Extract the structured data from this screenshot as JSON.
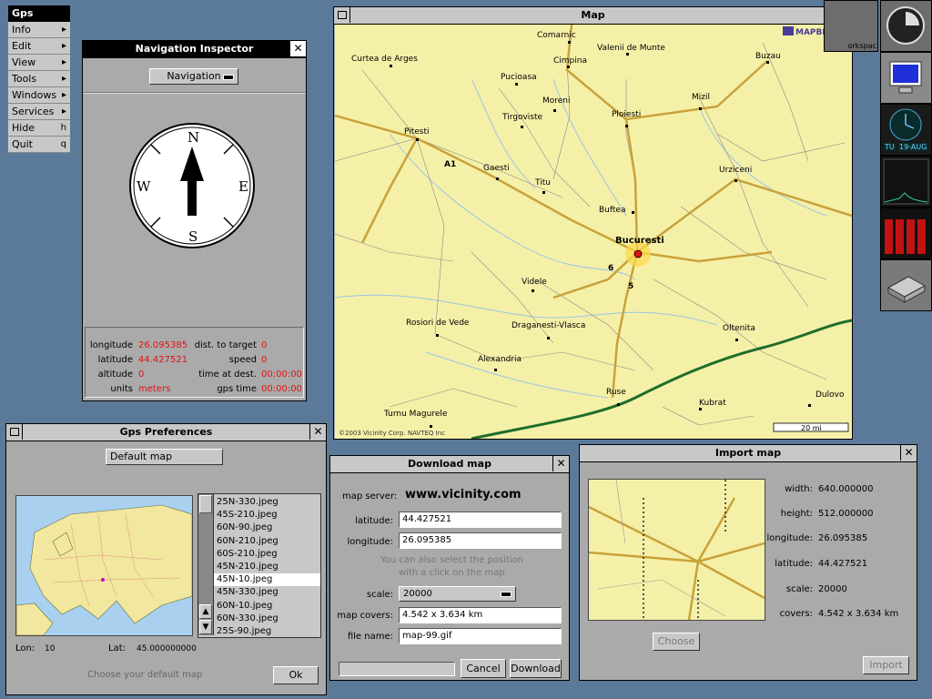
{
  "menu": {
    "title": "Gps",
    "items": [
      {
        "label": "Info",
        "key": "▸"
      },
      {
        "label": "Edit",
        "key": "▸"
      },
      {
        "label": "View",
        "key": "▸"
      },
      {
        "label": "Tools",
        "key": "▸"
      },
      {
        "label": "Windows",
        "key": "▸"
      },
      {
        "label": "Services",
        "key": "▸"
      },
      {
        "label": "Hide",
        "key": "h"
      },
      {
        "label": "Quit",
        "key": "q"
      }
    ]
  },
  "navigator": {
    "title": "Navigation Inspector",
    "mode": "Navigation",
    "compass": {
      "n": "N",
      "s": "S",
      "e": "E",
      "w": "W"
    },
    "longitude_label": "longitude",
    "longitude": "26.095385",
    "latitude_label": "latitude",
    "latitude": "44.427521",
    "altitude_label": "altitude",
    "altitude": "0",
    "units_label": "units",
    "units": "meters",
    "dist_label": "dist. to target",
    "dist": "0",
    "speed_label": "speed",
    "speed": "0",
    "time_dest_label": "time at dest.",
    "time_dest": "00:00:00",
    "gps_time_label": "gps time",
    "gps_time": "00:00:00"
  },
  "map_window": {
    "title": "Map",
    "brand": "MAPBLAST!",
    "copyright": "©2003 Vicinity Corp. NAVTEQ Inc",
    "scale_label": "20 mi",
    "cities": [
      "Comarnic",
      "Valenii de Munte",
      "Curtea de Arges",
      "Cimpina",
      "Buzau",
      "Pucioasa",
      "Moreni",
      "Mizil",
      "Tirgoviste",
      "Ploiesti",
      "Pitesti",
      "Gaesti",
      "Titu",
      "Urziceni",
      "Buftea",
      "Bucuresti",
      "Videle",
      "Rosiori de Vede",
      "Draganesti-Vlasca",
      "Oltenita",
      "Alexandria",
      "Ruse",
      "Kubrat",
      "Dulovo",
      "Turnu Magurele"
    ],
    "roads": [
      "A1",
      "6",
      "5"
    ]
  },
  "prefs": {
    "title": "Gps Preferences",
    "default_map_button": "Default map",
    "files": [
      "25N-330.jpeg",
      "45S-210.jpeg",
      "60N-90.jpeg",
      "60N-210.jpeg",
      "60S-210.jpeg",
      "45N-210.jpeg",
      "45N-10.jpeg",
      "45N-330.jpeg",
      "60N-10.jpeg",
      "60N-330.jpeg",
      "25S-90.jpeg"
    ],
    "selected_index": 6,
    "lon_label": "Lon:",
    "lon": "10",
    "lat_label": "Lat:",
    "lat": "45.000000000",
    "hint": "Choose your default map",
    "ok": "Ok"
  },
  "download": {
    "title": "Download map",
    "server_label": "map server:",
    "server": "www.vicinity.com",
    "latitude_label": "latitude:",
    "latitude": "44.427521",
    "longitude_label": "longitude:",
    "longitude": "26.095385",
    "hint1": "You can also select the position",
    "hint2": "with a click on the map",
    "scale_label": "scale:",
    "scale": "20000",
    "covers_label": "map covers:",
    "covers": "4.542 x 3.634 km",
    "file_label": "file name:",
    "file": "map-99.gif",
    "cancel": "Cancel",
    "download": "Download"
  },
  "import": {
    "title": "Import map",
    "width_label": "width:",
    "width": "640.000000",
    "height_label": "height:",
    "height": "512.000000",
    "longitude_label": "longitude:",
    "longitude": "26.095385",
    "latitude_label": "latitude:",
    "latitude": "44.427521",
    "scale_label": "scale:",
    "scale": "20000",
    "covers_label": "covers:",
    "covers": "4.542 x 3.634 km",
    "choose": "Choose",
    "import": "Import"
  },
  "dock": {
    "clock_day": "TU",
    "clock_date": "19-AUG",
    "workspace_label": "orkspac"
  },
  "colors": {
    "desktop": "#5b7a99",
    "map_bg": "#f5f0a8",
    "value_red": "#e21313"
  }
}
